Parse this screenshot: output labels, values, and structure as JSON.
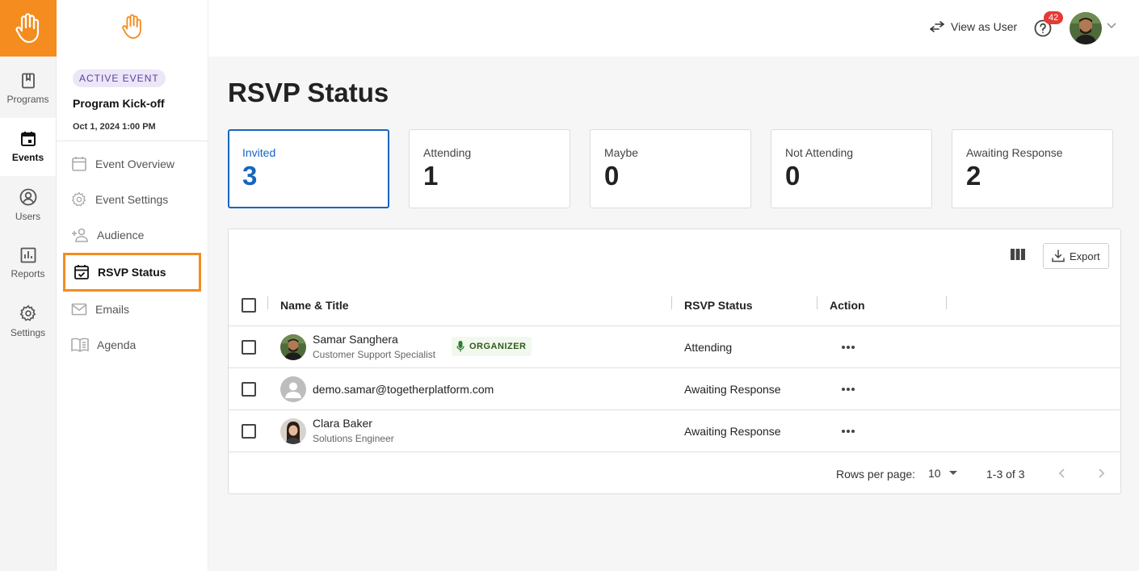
{
  "rail": {
    "items": [
      {
        "label": "Programs",
        "icon": "book-icon"
      },
      {
        "label": "Events",
        "icon": "calendar-icon"
      },
      {
        "label": "Users",
        "icon": "user-circle-icon"
      },
      {
        "label": "Reports",
        "icon": "bar-chart-icon"
      },
      {
        "label": "Settings",
        "icon": "gear-icon"
      }
    ],
    "active": "Events"
  },
  "sidebar": {
    "badge": "ACTIVE EVENT",
    "event_name": "Program Kick-off",
    "event_date": "Oct 1, 2024 1:00 PM",
    "items": [
      {
        "label": "Event Overview",
        "icon": "calendar-icon"
      },
      {
        "label": "Event Settings",
        "icon": "gear-icon"
      },
      {
        "label": "Audience",
        "icon": "add-person-icon"
      },
      {
        "label": "RSVP Status",
        "icon": "calendar-check-icon"
      },
      {
        "label": "Emails",
        "icon": "mail-icon"
      },
      {
        "label": "Agenda",
        "icon": "book-open-icon"
      }
    ],
    "active": "RSVP Status"
  },
  "header": {
    "view_as_user": "View as User",
    "notification_count": "42"
  },
  "page": {
    "title": "RSVP Status"
  },
  "summary": [
    {
      "label": "Invited",
      "value": "3"
    },
    {
      "label": "Attending",
      "value": "1"
    },
    {
      "label": "Maybe",
      "value": "0"
    },
    {
      "label": "Not Attending",
      "value": "0"
    },
    {
      "label": "Awaiting Response",
      "value": "2"
    }
  ],
  "table": {
    "export_label": "Export",
    "columns": [
      "Name & Title",
      "RSVP Status",
      "Action"
    ],
    "rows": [
      {
        "name": "Samar Sanghera",
        "title": "Customer Support Specialist",
        "tag": "ORGANIZER",
        "status": "Attending"
      },
      {
        "name": "demo.samar@togetherplatform.com",
        "title": "",
        "tag": "",
        "status": "Awaiting Response"
      },
      {
        "name": "Clara Baker",
        "title": "Solutions Engineer",
        "tag": "",
        "status": "Awaiting Response"
      }
    ],
    "rows_per_page_label": "Rows per page:",
    "rows_per_page": "10",
    "range": "1-3 of 3"
  },
  "colors": {
    "brand": "#f48c1f",
    "accent": "#1565c0",
    "badge_bg": "#ece6f7",
    "notification": "#e53935"
  }
}
